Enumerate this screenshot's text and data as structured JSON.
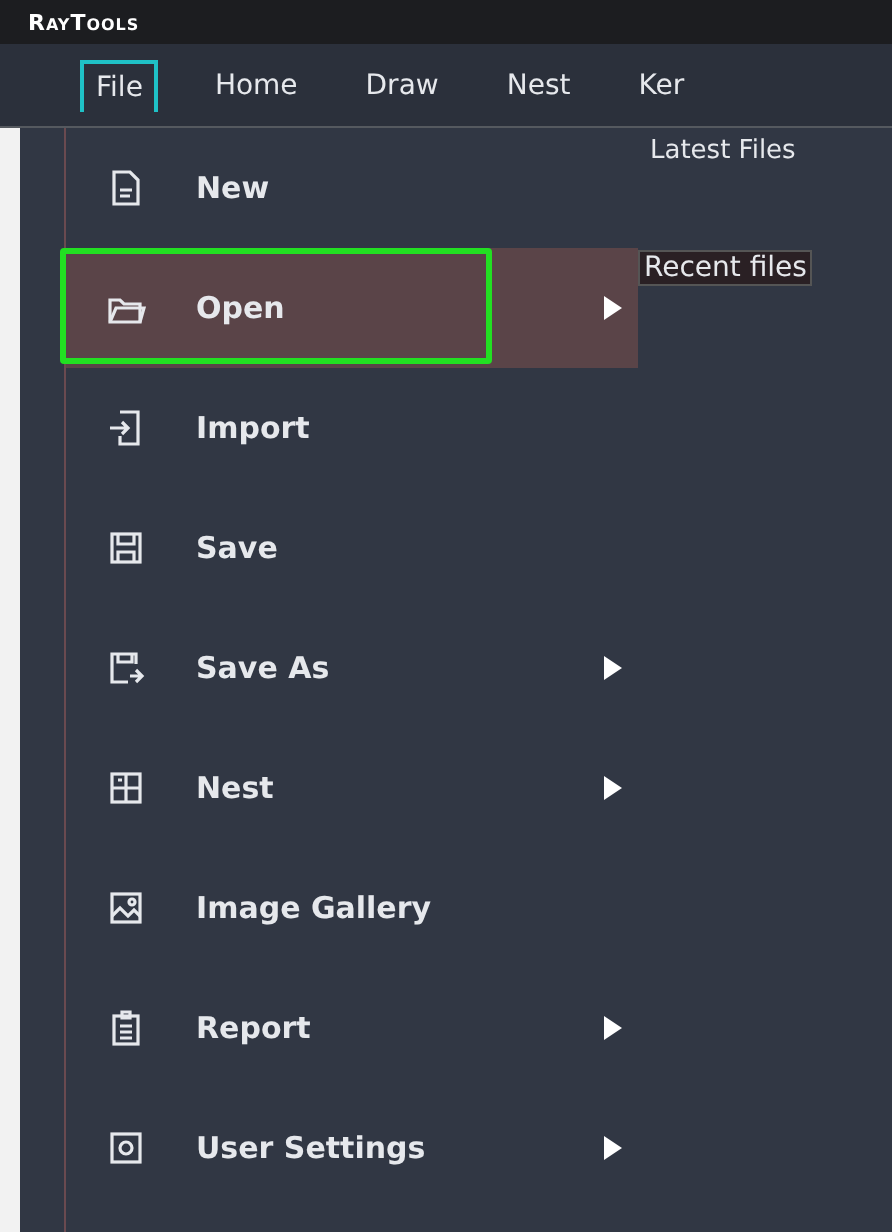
{
  "window": {
    "title": "RayTools"
  },
  "tabs": [
    {
      "label": "File",
      "selected": true
    },
    {
      "label": "Home",
      "selected": false
    },
    {
      "label": "Draw",
      "selected": false
    },
    {
      "label": "Nest",
      "selected": false
    },
    {
      "label": "Ker",
      "selected": false
    }
  ],
  "menu": {
    "items": [
      {
        "label": "New",
        "submenu": false,
        "selected": false
      },
      {
        "label": "Open",
        "submenu": true,
        "selected": true
      },
      {
        "label": "Import",
        "submenu": false,
        "selected": false
      },
      {
        "label": "Save",
        "submenu": false,
        "selected": false
      },
      {
        "label": "Save As",
        "submenu": true,
        "selected": false
      },
      {
        "label": "Nest",
        "submenu": true,
        "selected": false
      },
      {
        "label": "Image Gallery",
        "submenu": false,
        "selected": false
      },
      {
        "label": "Report",
        "submenu": true,
        "selected": false
      },
      {
        "label": "User Settings",
        "submenu": true,
        "selected": false
      }
    ]
  },
  "side_panel": {
    "title": "Latest Files",
    "section": "Recent files"
  }
}
